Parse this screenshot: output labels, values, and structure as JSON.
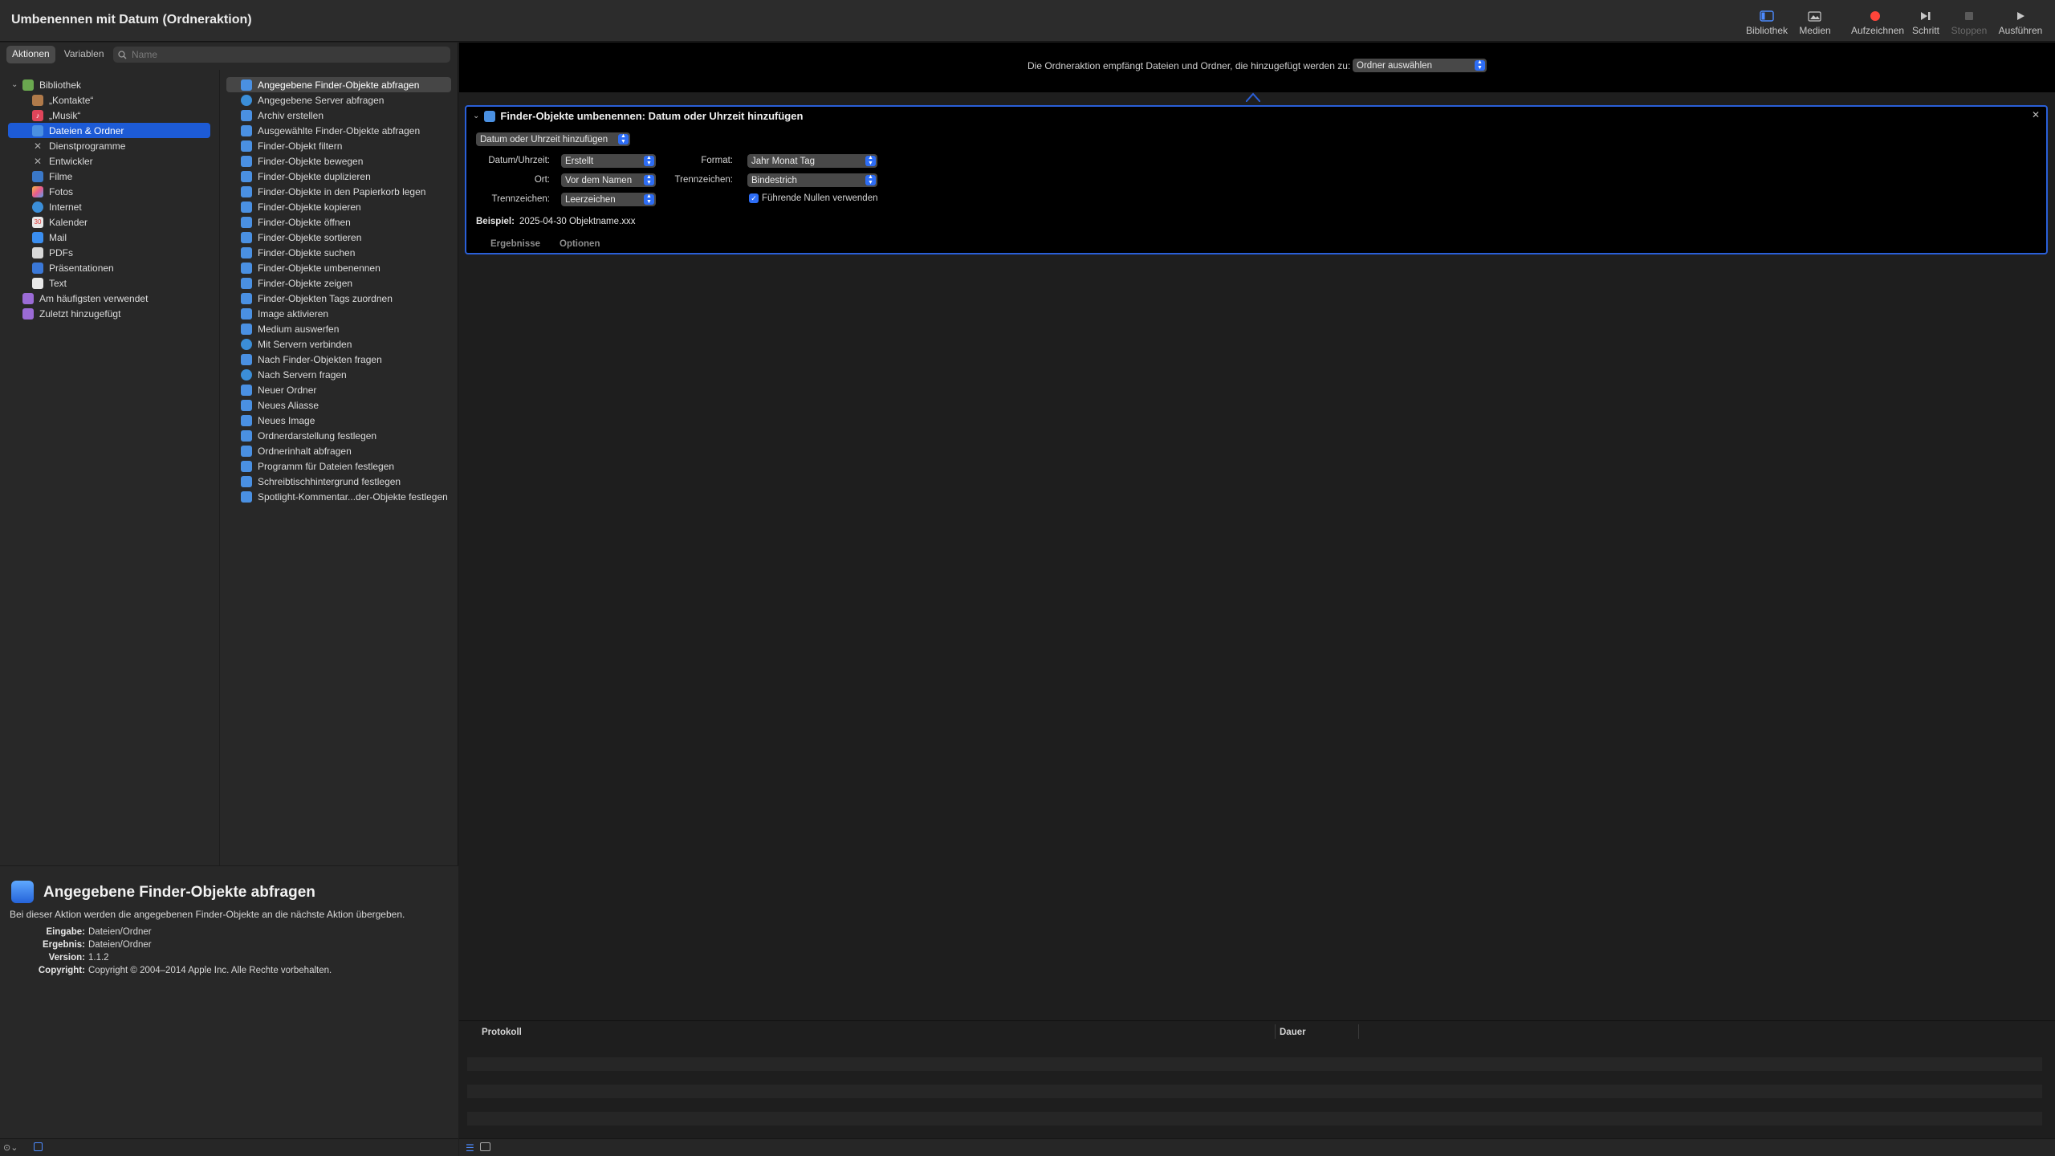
{
  "window": {
    "title": "Umbenennen mit Datum (Ordneraktion)"
  },
  "toolbar": {
    "library": "Bibliothek",
    "media": "Medien",
    "record": "Aufzeichnen",
    "step": "Schritt",
    "stop": "Stoppen",
    "run": "Ausführen",
    "record_color": "#ff453a"
  },
  "left": {
    "tabs": {
      "actions": "Aktionen",
      "variables": "Variablen"
    },
    "search": {
      "placeholder": "Name",
      "value": ""
    },
    "categories": [
      {
        "label": "Bibliothek",
        "icon": "library-icon"
      },
      {
        "label": "„Kontakte“",
        "icon": "contacts-icon"
      },
      {
        "label": "„Musik“",
        "icon": "music-icon"
      },
      {
        "label": "Dateien & Ordner",
        "icon": "finder-icon",
        "selected": true
      },
      {
        "label": "Dienstprogramme",
        "icon": "utilities-icon"
      },
      {
        "label": "Entwickler",
        "icon": "developer-icon"
      },
      {
        "label": "Filme",
        "icon": "movies-icon"
      },
      {
        "label": "Fotos",
        "icon": "photos-icon"
      },
      {
        "label": "Internet",
        "icon": "internet-icon"
      },
      {
        "label": "Kalender",
        "icon": "calendar-icon"
      },
      {
        "label": "Mail",
        "icon": "mail-icon"
      },
      {
        "label": "PDFs",
        "icon": "pdf-icon"
      },
      {
        "label": "Präsentationen",
        "icon": "presentations-icon"
      },
      {
        "label": "Text",
        "icon": "text-icon"
      },
      {
        "label": "Am häufigsten verwendet",
        "icon": "folder-icon"
      },
      {
        "label": "Zuletzt hinzugefügt",
        "icon": "folder-icon"
      }
    ],
    "actions": [
      "Angegebene Finder-Objekte abfragen",
      "Angegebene Server abfragen",
      "Archiv erstellen",
      "Ausgewählte Finder-Objekte abfragen",
      "Finder-Objekt filtern",
      "Finder-Objekte bewegen",
      "Finder-Objekte duplizieren",
      "Finder-Objekte in den Papierkorb legen",
      "Finder-Objekte kopieren",
      "Finder-Objekte öffnen",
      "Finder-Objekte sortieren",
      "Finder-Objekte suchen",
      "Finder-Objekte umbenennen",
      "Finder-Objekte zeigen",
      "Finder-Objekten Tags zuordnen",
      "Image aktivieren",
      "Medium auswerfen",
      "Mit Servern verbinden",
      "Nach Finder-Objekten fragen",
      "Nach Servern fragen",
      "Neuer Ordner",
      "Neues Aliasse",
      "Neues Image",
      "Ordnerdarstellung festlegen",
      "Ordnerinhalt abfragen",
      "Programm für Dateien festlegen",
      "Schreibtischhintergrund festlegen",
      "Spotlight-Kommentar...der-Objekte festlegen"
    ],
    "description": {
      "title": "Angegebene Finder-Objekte abfragen",
      "text": "Bei dieser Aktion werden die angegebenen Finder-Objekte an die nächste Aktion übergeben.",
      "input_label": "Eingabe:",
      "input": "Dateien/Ordner",
      "result_label": "Ergebnis:",
      "result": "Dateien/Ordner",
      "version_label": "Version:",
      "version": "1.1.2",
      "copyright_label": "Copyright:",
      "copyright": "Copyright © 2004–2014 Apple Inc. Alle Rechte vorbehalten."
    }
  },
  "workflow": {
    "header_text": "Die Ordneraktion empfängt Dateien und Ordner, die hinzugefügt werden zu:",
    "folder_select": "Ordner auswählen",
    "action": {
      "title": "Finder-Objekte umbenennen: Datum oder Uhrzeit hinzufügen",
      "mode": "Datum oder Uhrzeit hinzufügen",
      "date_label": "Datum/Uhrzeit:",
      "date_value": "Erstellt",
      "where_label": "Ort:",
      "where_value": "Vor dem Namen",
      "sep_label": "Trennzeichen:",
      "sep_value": "Leerzeichen",
      "format_label": "Format:",
      "format_value": "Jahr Monat Tag",
      "sep2_label": "Trennzeichen:",
      "sep2_value": "Bindestrich",
      "leading_zeros_label": "Führende Nullen verwenden",
      "leading_zeros_checked": true,
      "example_label": "Beispiel:",
      "example_value": "2025-04-30 Objektname.xxx",
      "tab_results": "Ergebnisse",
      "tab_options": "Optionen"
    },
    "log": {
      "col_log": "Protokoll",
      "col_duration": "Dauer"
    }
  }
}
